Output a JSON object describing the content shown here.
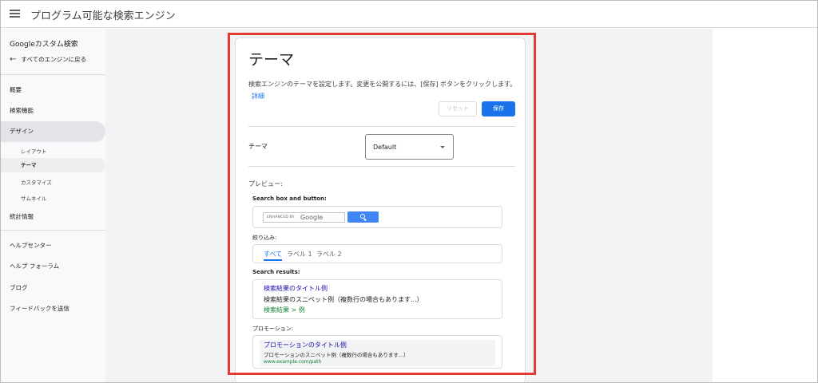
{
  "header": {
    "title": "プログラム可能な検索エンジン"
  },
  "sidebar": {
    "brand": "Googleカスタム検索",
    "back_label": "すべてのエンジンに戻る",
    "items": {
      "overview": "概要",
      "search_features": "検索機能",
      "design": "デザイン",
      "statistics": "統計情報",
      "help_center": "ヘルプセンター",
      "help_forum": "ヘルプ フォーラム",
      "blog": "ブログ",
      "feedback": "フィードバックを送信"
    },
    "design_subitems": {
      "layout": "レイアウト",
      "theme": "テーマ",
      "customize": "カスタマイズ",
      "thumbnail": "サムネイル"
    }
  },
  "card": {
    "title": "テーマ",
    "description": "検索エンジンのテーマを設定します。変更を公開するには、[保存] ボタンをクリックします。",
    "details_link": "詳細",
    "reset_button": "リセット",
    "save_button": "保存",
    "theme_label": "テーマ",
    "theme_select_value": "Default",
    "preview_label": "プレビュー:"
  },
  "preview": {
    "search_box_label": "Search box and button:",
    "enhanced_by": "ENHANCED BY",
    "google_text": "Google",
    "refine_label": "絞り込み:",
    "refine_tabs": [
      "すべて",
      "ラベル 1",
      "ラベル 2"
    ],
    "results_label": "Search results:",
    "result_title": "検索結果のタイトル例",
    "result_snippet": "検索結果のスニペット例（複数行の場合もあります...）",
    "result_url": "検索結果 > 例",
    "promotion_label": "プロモーション:",
    "promo_title": "プロモーションのタイトル例",
    "promo_snippet": "プロモーションのスニペット例（複数行の場合もあります...）",
    "promo_url": "www.example.com/path"
  },
  "colors": {
    "accent": "#1a73e8",
    "highlight": "#e53935",
    "link": "#1a0dab",
    "url_green": "#188038"
  }
}
